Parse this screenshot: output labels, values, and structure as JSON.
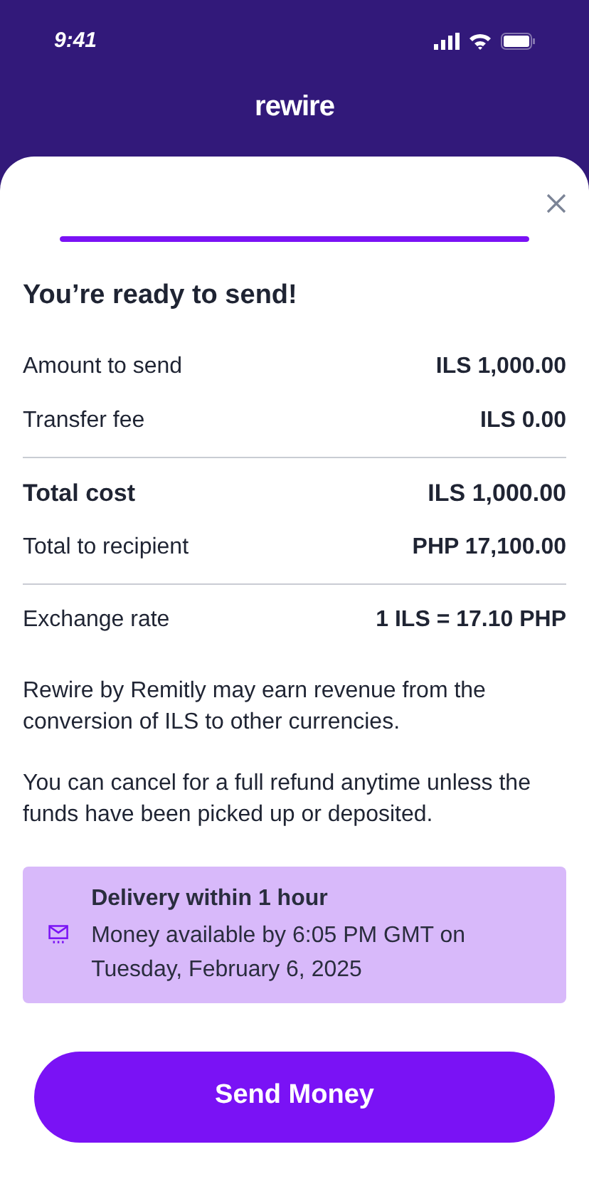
{
  "status_bar": {
    "time": "9:41"
  },
  "header": {
    "logo": "rewire"
  },
  "progress": {
    "level": 1
  },
  "title": "You’re ready to send!",
  "sections": [
    [
      {
        "label": "Amount to send",
        "value": "ILS 1,000.00",
        "bold": false
      },
      {
        "label": "Transfer fee",
        "value": "ILS 0.00",
        "bold": false
      }
    ],
    [
      {
        "label": "Total cost",
        "value": "ILS 1,000.00",
        "bold": true
      },
      {
        "label": "Total to recipient",
        "value": "PHP 17,100.00",
        "bold": false
      }
    ],
    [
      {
        "label": "Exchange rate",
        "value": "1 ILS = 17.10 PHP",
        "bold": false
      }
    ]
  ],
  "notes": [
    "Rewire by Remitly may earn revenue from the conversion of ILS to other currencies.",
    "You can cancel for a full refund anytime unless the funds have been picked up or deposited."
  ],
  "delivery": {
    "title": "Delivery within 1 hour",
    "detail": "Money available by 6:05 PM GMT on Tuesday, February 6, 2025"
  },
  "button": "Send Money"
}
